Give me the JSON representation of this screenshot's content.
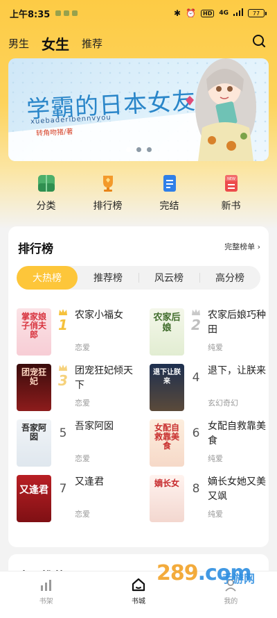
{
  "status_bar": {
    "time": "上午8:35",
    "network": "4G",
    "hd": "HD",
    "battery": "77"
  },
  "header": {
    "tabs": [
      {
        "label": "男生",
        "active": false
      },
      {
        "label": "女生",
        "active": true
      },
      {
        "label": "推荐",
        "active": false
      }
    ]
  },
  "banner": {
    "title": "学霸的日本女友",
    "subtitle": "xuebaderibennvyou",
    "author": "转角吻猪/著",
    "slide_count": 3,
    "active_slide": 0
  },
  "quick_nav": [
    {
      "label": "分类",
      "icon": "category-icon",
      "color": "#4caf6a"
    },
    {
      "label": "排行榜",
      "icon": "trophy-icon",
      "color": "#f39a2b"
    },
    {
      "label": "完结",
      "icon": "document-icon",
      "color": "#2f7fe8"
    },
    {
      "label": "新书",
      "icon": "new-book-icon",
      "color": "#ec4b4b"
    }
  ],
  "ranking": {
    "title": "排行榜",
    "more_label": "完整榜单 ›",
    "tabs": [
      {
        "label": "大热榜",
        "active": true
      },
      {
        "label": "推荐榜",
        "active": false
      },
      {
        "label": "风云榜",
        "active": false
      },
      {
        "label": "高分榜",
        "active": false
      }
    ],
    "books": [
      {
        "rank": "1",
        "title": "农家小福女",
        "tag": "恋爱",
        "cover_text": "掌家娘子俏夫郎"
      },
      {
        "rank": "2",
        "title": "农家后娘巧种田",
        "tag": "纯爱",
        "cover_text": "农家后娘"
      },
      {
        "rank": "3",
        "title": "团宠狂妃倾天下",
        "tag": "恋爱",
        "cover_text": "团宠狂妃"
      },
      {
        "rank": "4",
        "title": "退下，让朕来",
        "tag": "玄幻奇幻",
        "cover_text": "退下让朕来"
      },
      {
        "rank": "5",
        "title": "吾家阿囡",
        "tag": "恋爱",
        "cover_text": "吾家阿囡"
      },
      {
        "rank": "6",
        "title": "女配自救靠美食",
        "tag": "纯爱",
        "cover_text": "女配自救靠美食"
      },
      {
        "rank": "7",
        "title": "又逢君",
        "tag": "恋爱",
        "cover_text": "又逢君"
      },
      {
        "rank": "8",
        "title": "嫡长女她又美又飒",
        "tag": "纯爱",
        "cover_text": "嫡长女"
      }
    ]
  },
  "next_section": {
    "title": "本周推荐"
  },
  "bottom_nav": [
    {
      "label": "书架",
      "icon": "bookshelf-icon",
      "active": false
    },
    {
      "label": "书城",
      "icon": "home-icon",
      "active": true
    },
    {
      "label": "我的",
      "icon": "profile-icon",
      "active": false
    }
  ],
  "watermark": {
    "text": "289",
    "suffix": ".com",
    "sub": "手游网"
  }
}
